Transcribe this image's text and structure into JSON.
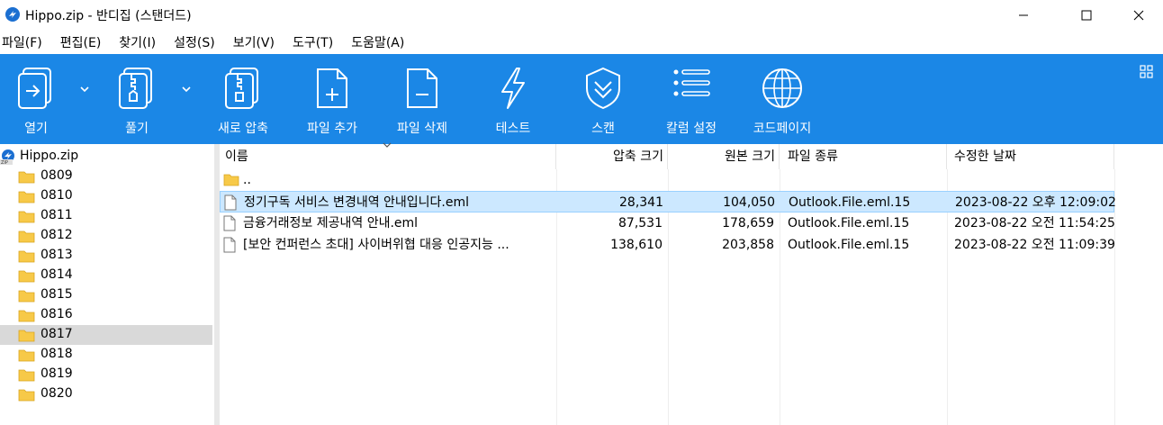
{
  "window": {
    "title": "Hippo.zip - 반디집 (스탠더드)"
  },
  "menu": [
    "파일(F)",
    "편집(E)",
    "찾기(I)",
    "설정(S)",
    "보기(V)",
    "도구(T)",
    "도움말(A)"
  ],
  "toolbar": {
    "open": "열기",
    "extract": "풀기",
    "new_archive": "새로 압축",
    "add_file": "파일 추가",
    "delete_file": "파일 삭제",
    "test": "테스트",
    "scan": "스캔",
    "column_settings": "칼럼 설정",
    "codepage": "코드페이지"
  },
  "tree": {
    "root": "Hippo.zip",
    "folders": [
      "0809",
      "0810",
      "0811",
      "0812",
      "0813",
      "0814",
      "0815",
      "0816",
      "0817",
      "0818",
      "0819",
      "0820"
    ],
    "selected_folder": "0817"
  },
  "columns": {
    "name": "이름",
    "compressed": "압축 크기",
    "original": "원본 크기",
    "type": "파일 종류",
    "modified": "수정한 날짜"
  },
  "parent_row": "..",
  "files": [
    {
      "name": "정기구독 서비스 변경내역 안내입니다.eml",
      "compressed": "28,341",
      "original": "104,050",
      "type": "Outlook.File.eml.15",
      "modified": "2023-08-22 오후 12:09:02"
    },
    {
      "name": "금융거래정보 제공내역 안내.eml",
      "compressed": "87,531",
      "original": "178,659",
      "type": "Outlook.File.eml.15",
      "modified": "2023-08-22 오전 11:54:25"
    },
    {
      "name": "[보안 컨퍼런스 초대] 사이버위협 대응 인공지능 ...",
      "compressed": "138,610",
      "original": "203,858",
      "type": "Outlook.File.eml.15",
      "modified": "2023-08-22 오전 11:09:39"
    }
  ],
  "colors": {
    "toolbar_bg": "#1b87e6",
    "selection_bg": "#cce8ff",
    "folder": "#f7c948"
  }
}
